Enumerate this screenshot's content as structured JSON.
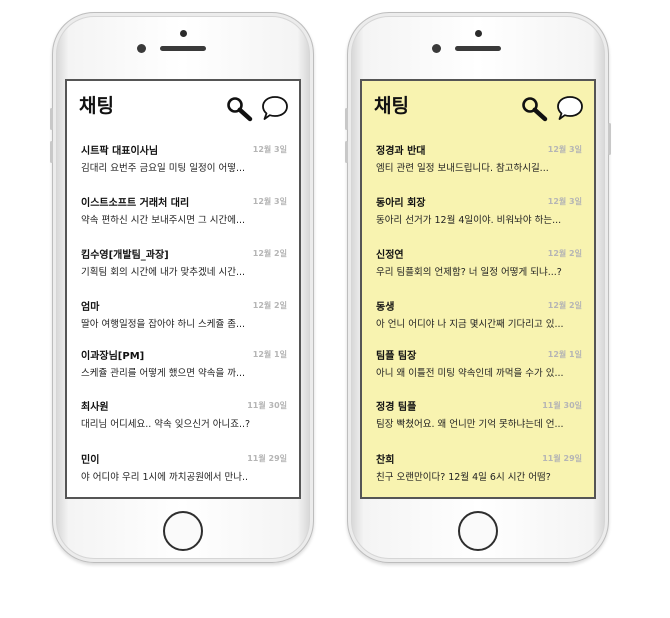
{
  "left_screen": {
    "title": "채팅",
    "background": "#ffffff",
    "chats": [
      {
        "name": "시트팍 대표이사님",
        "date": "12월 3일",
        "message": "김대리 요번주 금요일 미팅 일정이 어떻..."
      },
      {
        "name": "이스트소프트 거래처 대리",
        "date": "12월 3일",
        "message": "약속 편하신 시간 보내주시면 그 시간에..."
      },
      {
        "name": "킴수영[개발팀_과장]",
        "date": "12월 2일",
        "message": "기획팀 회의 시간에 내가 맞추겠네 시간..."
      },
      {
        "name": "엄마",
        "date": "12월 2일",
        "message": "딸아 여행일정을 잡아야 하니 스케쥴 좀..."
      },
      {
        "name": "이과장님[PM]",
        "date": "12월 1일",
        "message": "스케쥴 관리를 어떻게 했으면 약속을 까..."
      },
      {
        "name": "최사원",
        "date": "11월 30일",
        "message": "대리님 어디세요.. 약속 잊으신거 아니죠..?"
      },
      {
        "name": "민이",
        "date": "11월 29일",
        "message": "야 어디야 우리 1시에 까치공원에서 만나.."
      }
    ]
  },
  "right_screen": {
    "title": "채팅",
    "background": "#f8f3b0",
    "chats": [
      {
        "name": "정경과 반대",
        "date": "12월 3일",
        "message": "엠티 관련  일정 보내드립니다. 참고하시길..."
      },
      {
        "name": "동아리 회장",
        "date": "12월 3일",
        "message": "동아리 선거가 12월 4일이야. 비워놔야 하는..."
      },
      {
        "name": "신정연",
        "date": "12월 2일",
        "message": "우리 팀플회의 언제함? 너 일정 어떻게 되냐...?"
      },
      {
        "name": "동생",
        "date": "12월 2일",
        "message": "아 언니 어디야 나 지금 몇시간째 기다리고 있..."
      },
      {
        "name": "팀플 팀장",
        "date": "12월 1일",
        "message": "아니 왜 이틀전 미팅 약속인데 까먹을 수가 있..."
      },
      {
        "name": "정경 팀플",
        "date": "11월 30일",
        "message": "팀장 빡쳤어요. 왜 언니만 기억 못하냐는데 언..."
      },
      {
        "name": "찬희",
        "date": "11월 29일",
        "message": "친구 오랜만이다? 12월 4일 6시 시간 어떰?"
      }
    ]
  },
  "icons": {
    "search": "search-icon",
    "chat": "chat-bubble-icon"
  }
}
